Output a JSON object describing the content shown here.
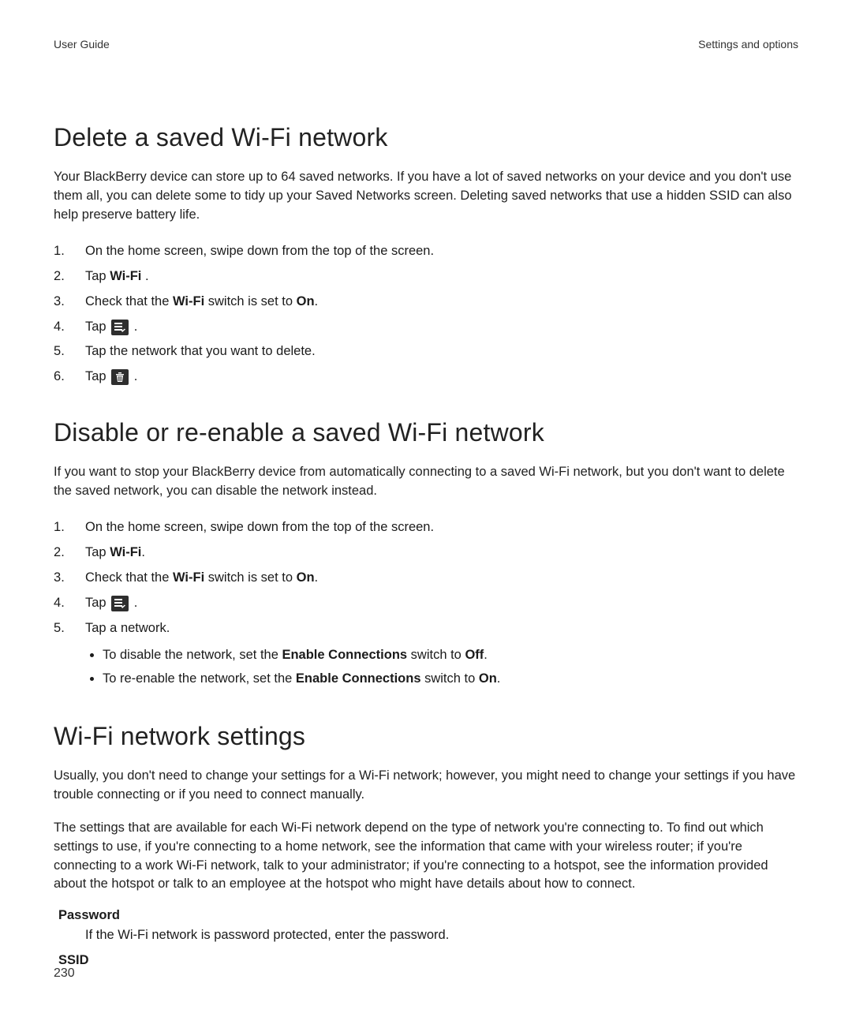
{
  "header": {
    "left": "User Guide",
    "right": "Settings and options"
  },
  "sections": {
    "delete": {
      "title": "Delete a saved Wi-Fi network",
      "intro": "Your BlackBerry device can store up to 64 saved networks. If you have a lot of saved networks on your device and you don't use them all, you can delete some to tidy up your Saved Networks screen. Deleting saved networks that use a hidden SSID can also help preserve battery life.",
      "steps": {
        "s1": "On the home screen, swipe down from the top of the screen.",
        "s2_pre": "Tap ",
        "s2_bold": "Wi-Fi ",
        "s2_post": ".",
        "s3_pre": "Check that the ",
        "s3_b1": "Wi-Fi",
        "s3_mid": " switch is set to ",
        "s3_b2": "On",
        "s3_post": ".",
        "s4_pre": "Tap ",
        "s4_post": " .",
        "s5": "Tap the network that you want to delete.",
        "s6_pre": "Tap ",
        "s6_post": " ."
      }
    },
    "disable": {
      "title": "Disable or re-enable a saved Wi-Fi network",
      "intro": "If you want to stop your BlackBerry device from automatically connecting to a saved Wi-Fi network, but you don't want to delete the saved network, you can disable the network instead.",
      "steps": {
        "s1": "On the home screen, swipe down from the top of the screen.",
        "s2_pre": "Tap ",
        "s2_bold": "Wi-Fi",
        "s2_post": ".",
        "s3_pre": "Check that the ",
        "s3_b1": "Wi-Fi",
        "s3_mid": " switch is set to ",
        "s3_b2": "On",
        "s3_post": ".",
        "s4_pre": "Tap ",
        "s4_post": " .",
        "s5": "Tap a network.",
        "sub_a_pre": "To disable the network, set the ",
        "sub_a_b": "Enable Connections",
        "sub_a_mid": " switch to ",
        "sub_a_b2": "Off",
        "sub_a_post": ".",
        "sub_b_pre": "To re-enable the network, set the ",
        "sub_b_b": "Enable Connections",
        "sub_b_mid": " switch to ",
        "sub_b_b2": "On",
        "sub_b_post": "."
      }
    },
    "settings": {
      "title": "Wi-Fi network settings",
      "p1": "Usually, you don't need to change your settings for a Wi-Fi network; however, you might need to change your settings if you have trouble connecting or if you need to connect manually.",
      "p2": "The settings that are available for each Wi-Fi network depend on the type of network you're connecting to. To find out which settings to use, if you're connecting to a home network, see the information that came with your wireless router; if you're connecting to a work Wi-Fi network, talk to your administrator; if you're connecting to a hotspot, see the information provided about the hotspot or talk to an employee at the hotspot who might have details about how to connect.",
      "term_password": "Password",
      "def_password": "If the Wi-Fi network is password protected, enter the password.",
      "term_ssid": "SSID"
    }
  },
  "page_number": "230"
}
